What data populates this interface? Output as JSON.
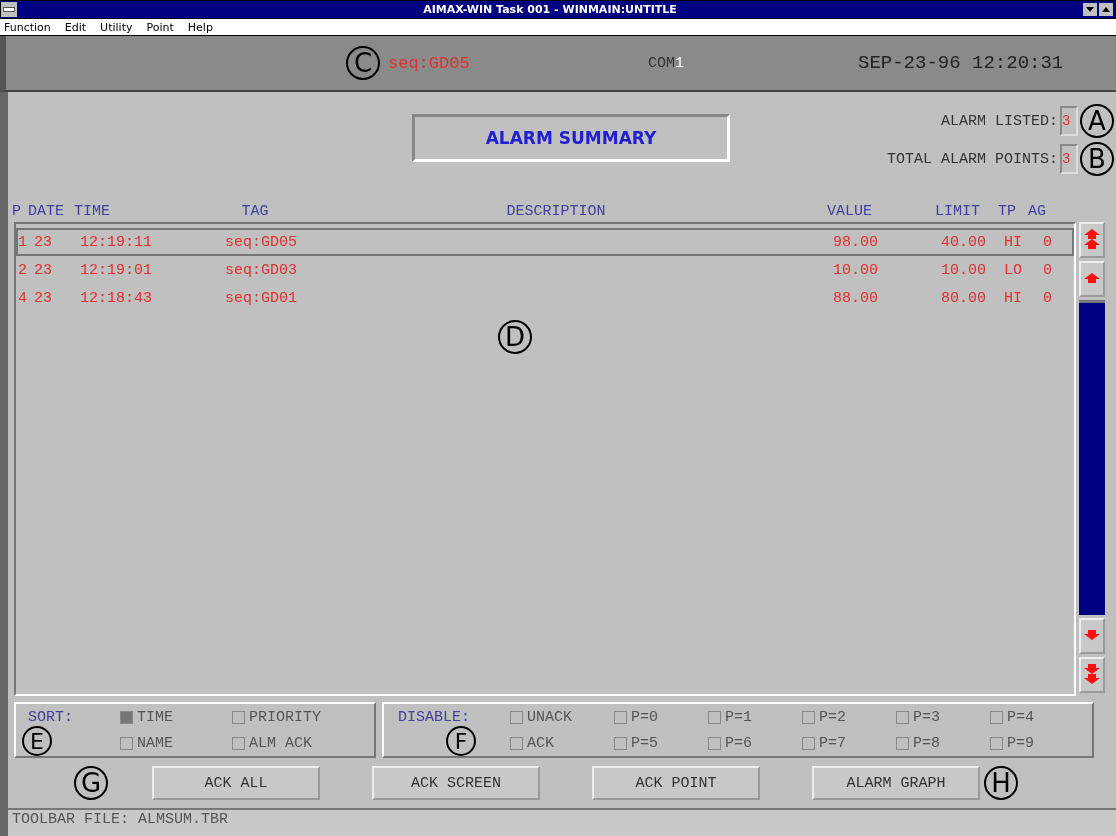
{
  "window": {
    "title": "AIMAX-WIN Task 001 - WINMAIN:UNTITLE"
  },
  "menu": [
    "Function",
    "Edit",
    "Utility",
    "Point",
    "Help"
  ],
  "header": {
    "callout": "C",
    "tag": "seq:GD05",
    "com_label": "COM",
    "com_number": "1",
    "datetime": "SEP-23-96 12:20:31"
  },
  "summary_title": "ALARM SUMMARY",
  "counters": [
    {
      "label": "ALARM LISTED:",
      "value": "3",
      "callout": "A"
    },
    {
      "label": "TOTAL ALARM POINTS:",
      "value": "3",
      "callout": "B"
    }
  ],
  "table": {
    "columns": [
      "P",
      "DATE",
      "TIME",
      "TAG",
      "DESCRIPTION",
      "VALUE",
      "LIMIT",
      "TP",
      "AG"
    ],
    "callout": "D",
    "rows": [
      {
        "selected": true,
        "cells": [
          "1",
          "23",
          "12:19:11",
          "seq:GD05",
          "",
          "98.00",
          "40.00",
          "HI",
          "0"
        ]
      },
      {
        "selected": false,
        "cells": [
          "2",
          "23",
          "12:19:01",
          "seq:GD03",
          "",
          "10.00",
          "10.00",
          "LO",
          "0"
        ]
      },
      {
        "selected": false,
        "cells": [
          "4",
          "23",
          "12:18:43",
          "seq:GD01",
          "",
          "88.00",
          "80.00",
          "HI",
          "0"
        ]
      }
    ]
  },
  "sort": {
    "label": "SORT:",
    "callout": "E",
    "options": [
      {
        "label": "TIME",
        "checked": true
      },
      {
        "label": "PRIORITY",
        "checked": false
      },
      {
        "label": "NAME",
        "checked": false
      },
      {
        "label": "ALM ACK",
        "checked": false
      }
    ]
  },
  "disable": {
    "label": "DISABLE:",
    "callout": "F",
    "options": [
      {
        "label": "UNACK",
        "checked": false
      },
      {
        "label": "P=0",
        "checked": false
      },
      {
        "label": "P=1",
        "checked": false
      },
      {
        "label": "P=2",
        "checked": false
      },
      {
        "label": "P=3",
        "checked": false
      },
      {
        "label": "P=4",
        "checked": false
      },
      {
        "label": "ACK",
        "checked": false
      },
      {
        "label": "P=5",
        "checked": false
      },
      {
        "label": "P=6",
        "checked": false
      },
      {
        "label": "P=7",
        "checked": false
      },
      {
        "label": "P=8",
        "checked": false
      },
      {
        "label": "P=9",
        "checked": false
      }
    ]
  },
  "buttons_callout_left": "G",
  "buttons": [
    "ACK ALL",
    "ACK SCREEN",
    "ACK POINT",
    "ALARM GRAPH"
  ],
  "buttons_callout_right": "H",
  "status_bar": "TOOLBAR FILE: ALMSUM.TBR"
}
